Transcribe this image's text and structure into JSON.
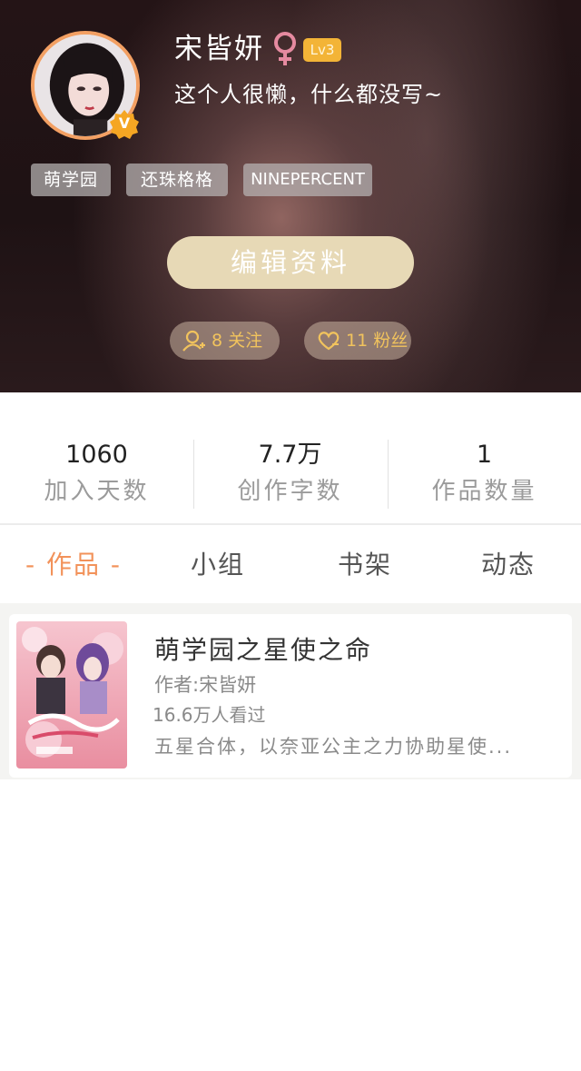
{
  "profile": {
    "name": "宋皆妍",
    "gender_symbol": "♀",
    "level": "Lv3",
    "bio": "这个人很懒，什么都没写~",
    "verified_mark": "V",
    "tags": [
      "萌学园",
      "还珠格格",
      "NINEPERCENT"
    ],
    "edit_button": "编辑资料",
    "following": "8 关注",
    "fans": "11 粉丝"
  },
  "stats": [
    {
      "value": "1060",
      "label": "加入天数"
    },
    {
      "value": "7.7万",
      "label": "创作字数"
    },
    {
      "value": "1",
      "label": "作品数量"
    }
  ],
  "tabs": {
    "active": "- 作品 -",
    "groups": "小组",
    "bookshelf": "书架",
    "activity": "动态"
  },
  "works": [
    {
      "title": "萌学园之星使之命",
      "author": "作者:宋皆妍",
      "views": "16.6万人看过",
      "description": "五星合体，以奈亚公主之力协助星使..."
    }
  ],
  "colors": {
    "accent": "#f2925a",
    "avatar_ring": "#f3a063",
    "level_badge": "#f3b437",
    "edit_button": "#e7d9b6",
    "pill_text": "#f1c35d",
    "gender": "#e58aa0"
  }
}
